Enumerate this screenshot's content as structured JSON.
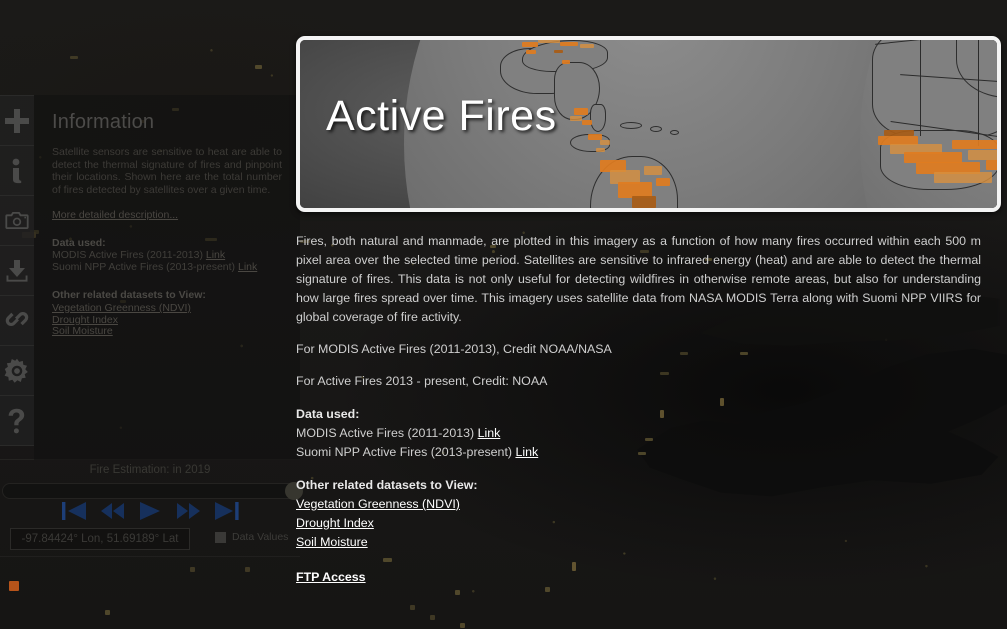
{
  "rail": {
    "items": [
      {
        "name": "add-layer",
        "icon": "plus-icon"
      },
      {
        "name": "information",
        "icon": "info-icon"
      },
      {
        "name": "snapshot",
        "icon": "camera-icon"
      },
      {
        "name": "download",
        "icon": "download-icon"
      },
      {
        "name": "share-link",
        "icon": "chain-link-icon"
      },
      {
        "name": "settings",
        "icon": "gear-icon"
      },
      {
        "name": "help",
        "icon": "question-mark-icon"
      }
    ]
  },
  "info_panel": {
    "title": "Information",
    "body": "Satellite sensors are sensitive to heat are able to detect the thermal signature of fires and pinpoint their locations. Shown here are the total number of fires detected by satellites over a given time.",
    "more_link": "More detailed description...",
    "data_used_heading": "Data used:",
    "data_used": [
      {
        "text": "MODIS Active Fires (2011-2013)",
        "link": "Link"
      },
      {
        "text": "Suomi NPP Active Fires (2013-present)",
        "link": "Link"
      }
    ],
    "related_heading": "Other related datasets to View:",
    "related": [
      "Vegetation Greenness (NDVI)",
      "Drought Index",
      "Soil Moisture"
    ]
  },
  "time_controls": {
    "label": "Fire Estimation: in 2019",
    "buttons": [
      {
        "name": "skip-to-start-button",
        "icon": "skip-back-icon"
      },
      {
        "name": "step-backward-button",
        "icon": "rewind-icon"
      },
      {
        "name": "play-button",
        "icon": "play-icon"
      },
      {
        "name": "step-forward-button",
        "icon": "fast-forward-icon"
      },
      {
        "name": "skip-to-end-button",
        "icon": "skip-forward-icon"
      }
    ],
    "coordinates": "-97.84424° Lon, 51.69189° Lat",
    "data_values_label": "Data Values"
  },
  "dialog": {
    "banner_title": "Active Fires",
    "paragraphs": [
      "Fires, both natural and manmade, are plotted in this imagery as a function of how many fires occurred within each 500 m pixel area over the selected time period. Satellites are sensitive to infrared energy (heat) and are able to detect the thermal signature of fires. This data is not only useful for detecting wildfires in otherwise remote areas, but also for understanding how large fires spread over time. This imagery uses satellite data from NASA MODIS Terra along with Suomi NPP VIIRS for global coverage of fire activity.",
      "For MODIS Active Fires (2011-2013), Credit NOAA/NASA",
      "For Active Fires 2013 - present, Credit: NOAA"
    ],
    "data_used_heading": "Data used:",
    "data_used": [
      {
        "text": "MODIS Active Fires (2011-2013)",
        "link": "Link"
      },
      {
        "text": "Suomi NPP Active Fires (2013-present)",
        "link": "Link"
      }
    ],
    "related_heading": "Other related datasets to View:",
    "related": [
      "Vegetation Greenness (NDVI)",
      "Drought Index",
      "Soil Moisture"
    ],
    "ftp_label": "FTP Access"
  },
  "colors": {
    "fire_orange": "#e07c20",
    "dialog_border": "#f4f4f4",
    "playback_blue": "#16305c",
    "background": "#181716"
  }
}
